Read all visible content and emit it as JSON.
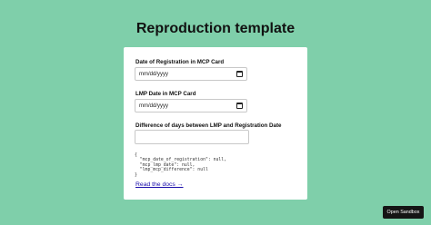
{
  "page": {
    "title": "Reproduction template"
  },
  "form": {
    "registration_label": "Date of Registration in MCP Card",
    "registration_value": "mm/dd/yyyy",
    "lmp_label": "LMP Date in MCP Card",
    "lmp_value": "mm/dd/yyyy",
    "difference_label": "Difference of days between LMP and Registration Date",
    "difference_value": ""
  },
  "json_output": {
    "line1": "{",
    "line2": "  \"mcp_date_of_registration\": null,",
    "line3": "  \"mcp_lmp_date\": null,",
    "line4": "  \"lmp_mcp_difference\": null",
    "line5": "}"
  },
  "docs_link": {
    "label": "Read the docs →"
  },
  "sandbox": {
    "label": "Open Sandbox"
  },
  "icons": {
    "date_picker": "calendar-icon"
  }
}
